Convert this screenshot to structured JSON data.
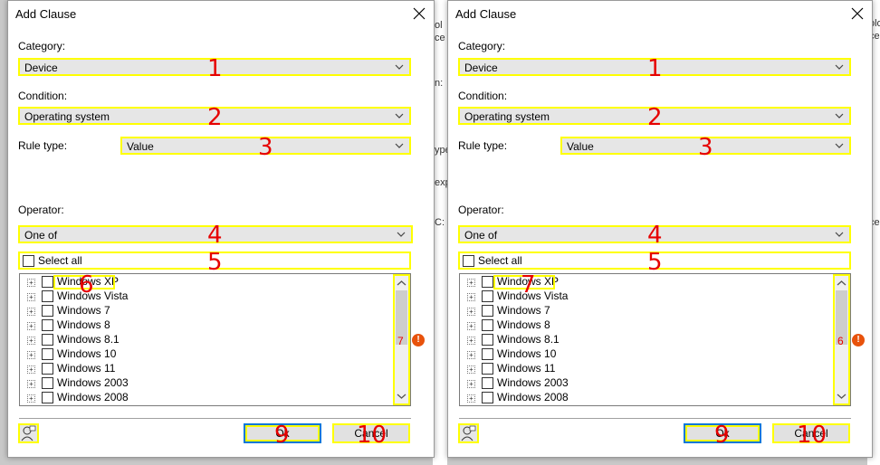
{
  "background": {
    "left_strip": [
      "ol",
      "ce",
      "n:",
      "ype",
      "exp",
      "C:"
    ],
    "right_strip": [
      "olo",
      "ce:",
      "ce"
    ]
  },
  "dialogs": [
    {
      "title": "Add Clause",
      "category_label": "Category:",
      "category_value": "Device",
      "condition_label": "Condition:",
      "condition_value": "Operating system",
      "rule_type_label": "Rule type:",
      "rule_type_value": "Value",
      "operator_label": "Operator:",
      "operator_value": "One of",
      "select_all_label": "Select all",
      "items": [
        "Windows XP",
        "Windows Vista",
        "Windows 7",
        "Windows 8",
        "Windows 8.1",
        "Windows 10",
        "Windows 11",
        "Windows 2003",
        "Windows 2008"
      ],
      "ok_label": "Ok",
      "cancel_label": "Cancel",
      "markers": {
        "m1": "1",
        "m2": "2",
        "m3": "3",
        "m4": "4",
        "m5": "5",
        "m6": "6",
        "m7": "7",
        "m9": "9",
        "m10": "10"
      }
    },
    {
      "title": "Add Clause",
      "category_label": "Category:",
      "category_value": "Device",
      "condition_label": "Condition:",
      "condition_value": "Operating system",
      "rule_type_label": "Rule type:",
      "rule_type_value": "Value",
      "operator_label": "Operator:",
      "operator_value": "One of",
      "select_all_label": "Select all",
      "items": [
        "Windows XP",
        "Windows Vista",
        "Windows 7",
        "Windows 8",
        "Windows 8.1",
        "Windows 10",
        "Windows 11",
        "Windows 2003",
        "Windows 2008"
      ],
      "ok_label": "Ok",
      "cancel_label": "Cancel",
      "markers": {
        "m1": "1",
        "m2": "2",
        "m3": "3",
        "m4": "4",
        "m5": "5",
        "m6": "6",
        "m7": "7",
        "m9": "9",
        "m10": "10"
      }
    }
  ],
  "colors": {
    "highlight": "#ffff00",
    "marker": "#e60000",
    "warning": "#e8520b",
    "focus": "#0078d7"
  },
  "icons": {
    "close": "close-icon",
    "chevron": "chevron-down-icon",
    "expand": "expand-plus-icon",
    "warning": "warning-icon",
    "user": "user-icon"
  }
}
